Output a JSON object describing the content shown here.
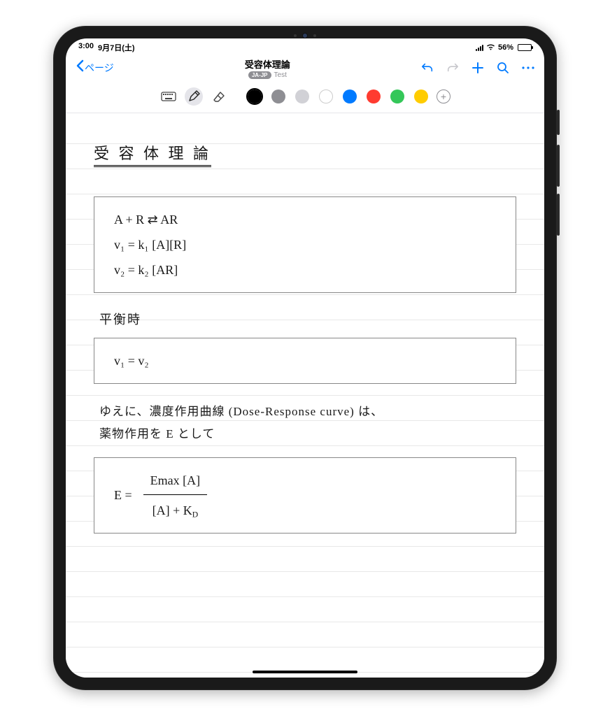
{
  "status": {
    "time": "3:00",
    "date": "9月7日(土)",
    "battery_percent": "56%"
  },
  "nav": {
    "back_label": "ページ",
    "title": "受容体理論",
    "lang_pill": "JA-JP",
    "subtitle": "Test"
  },
  "tools": {
    "keyboard": "keyboard",
    "pen": "pen",
    "eraser": "eraser"
  },
  "colors": {
    "values": [
      "#000000",
      "#8e8e93",
      "#d1d1d6",
      "#ffffff",
      "#007aff",
      "#ff3b30",
      "#34c759",
      "#ffcc00"
    ],
    "selected_index": 0
  },
  "notes": {
    "title": "受 容 体 理 論",
    "box1_line1": "A + R ⇄ AR",
    "box1_line2": "v₁ = k₁ [A][R]",
    "box1_line3": "v₂ = k₂ [AR]",
    "line_eq": "平衡時",
    "box2": "v₁ = v₂",
    "para1_a": "ゆえに、濃度作用曲線 (Dose-Response curve) は、",
    "para1_b": "薬物作用を E として",
    "box3_lhs": "E =",
    "box3_num": "Emax [A]",
    "box3_den": "[A] + K",
    "box3_den_sub": "D"
  }
}
